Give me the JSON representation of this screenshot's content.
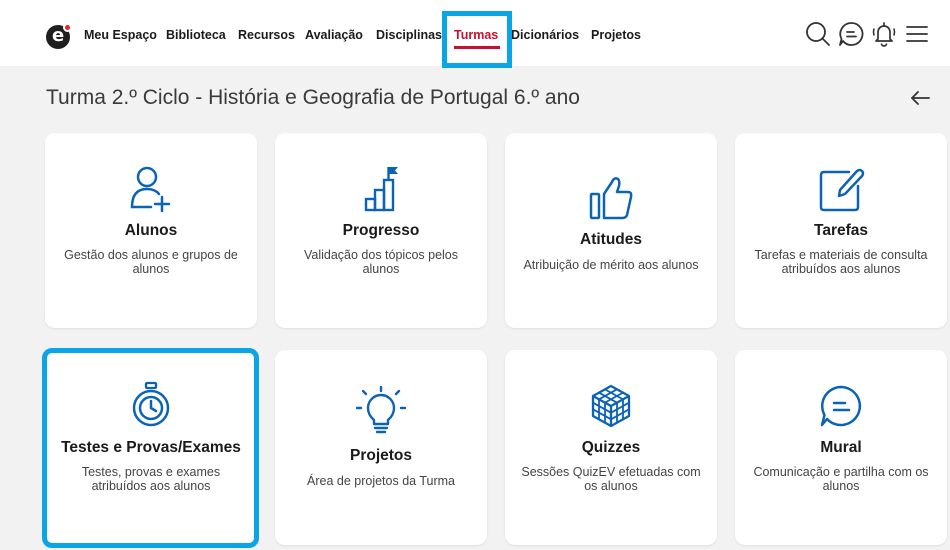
{
  "nav": {
    "items": [
      {
        "label": "Meu Espaço",
        "active": false
      },
      {
        "label": "Biblioteca",
        "active": false
      },
      {
        "label": "Recursos",
        "active": false
      },
      {
        "label": "Avaliação",
        "active": false
      },
      {
        "label": "Disciplinas",
        "active": false
      },
      {
        "label": "Turmas",
        "active": true
      },
      {
        "label": "Dicionários",
        "active": false
      },
      {
        "label": "Projetos",
        "active": false
      }
    ]
  },
  "header": {
    "title": "Turma 2.º Ciclo - História e Geografia de Portugal 6.º ano"
  },
  "cards": [
    {
      "title": "Alunos",
      "desc": "Gestão dos alunos e grupos de alunos",
      "icon": "add-user-icon"
    },
    {
      "title": "Progresso",
      "desc": "Validação dos tópicos pelos alunos",
      "icon": "progress-chart-icon"
    },
    {
      "title": "Atitudes",
      "desc": "Atribuição de mérito aos alunos",
      "icon": "thumbs-up-icon"
    },
    {
      "title": "Tarefas",
      "desc": "Tarefas e materiais de consulta atribuídos aos alunos",
      "icon": "edit-icon"
    },
    {
      "title": "Testes e Provas/Exames",
      "desc": "Testes, provas e exames atribuídos aos alunos",
      "icon": "stopwatch-icon"
    },
    {
      "title": "Projetos",
      "desc": "Área de projetos da Turma",
      "icon": "lightbulb-icon"
    },
    {
      "title": "Quizzes",
      "desc": "Sessões QuizEV efetuadas com os alunos",
      "icon": "cube-icon"
    },
    {
      "title": "Mural",
      "desc": "Comunicação e partilha com os alunos",
      "icon": "chat-icon"
    }
  ],
  "colors": {
    "accent_blue": "#0b63b6",
    "active_red": "#c8102e",
    "highlight": "#0aa5e6"
  }
}
